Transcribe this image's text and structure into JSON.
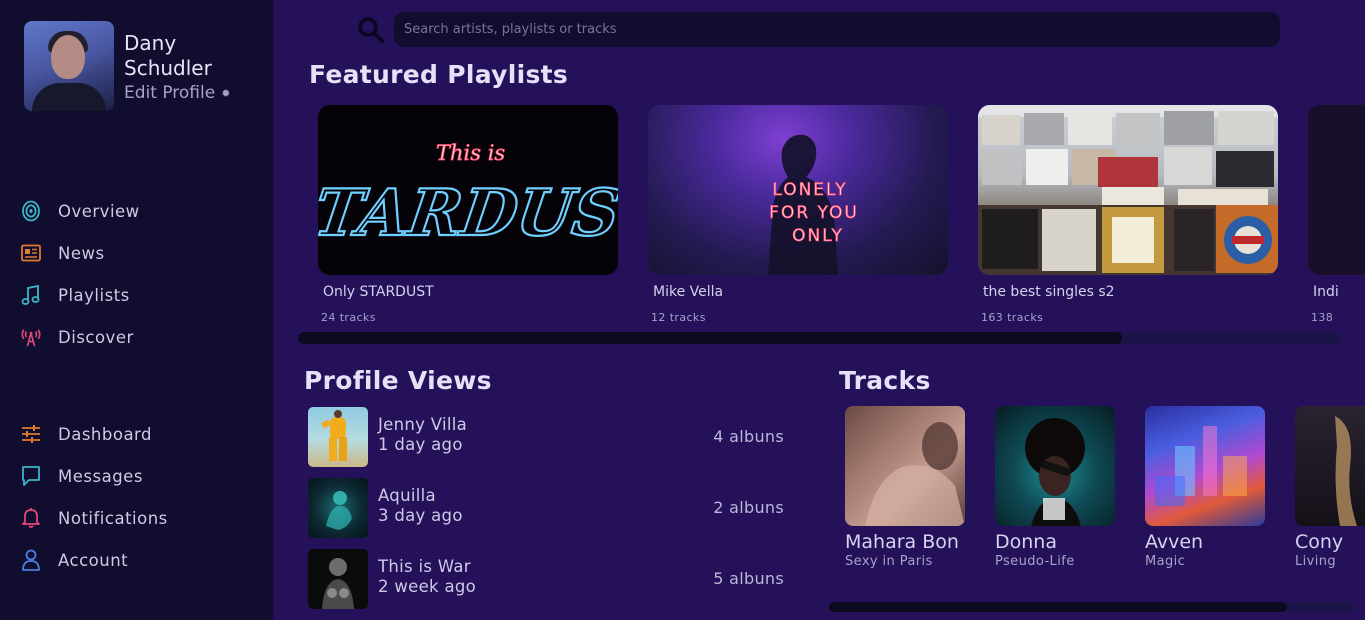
{
  "user": {
    "name": "Dany Schudler",
    "edit_label": "Edit Profile"
  },
  "nav": {
    "primary": [
      {
        "label": "Overview",
        "icon": "target-icon",
        "color": "#3bb5c7"
      },
      {
        "label": "News",
        "icon": "newspaper-icon",
        "color": "#e07a2f"
      },
      {
        "label": "Playlists",
        "icon": "music-note-icon",
        "color": "#3bb5c7"
      },
      {
        "label": "Discover",
        "icon": "broadcast-icon",
        "color": "#e0477a"
      }
    ],
    "secondary": [
      {
        "label": "Dashboard",
        "icon": "sliders-icon",
        "color": "#e07a2f"
      },
      {
        "label": "Messages",
        "icon": "chat-icon",
        "color": "#3bb5c7"
      },
      {
        "label": "Notifications",
        "icon": "bell-icon",
        "color": "#e0477a"
      },
      {
        "label": "Account",
        "icon": "user-icon",
        "color": "#4a7ee0"
      }
    ]
  },
  "search": {
    "placeholder": "Search artists, playlists or tracks"
  },
  "featured": {
    "title": "Featured Playlists",
    "playlists": [
      {
        "name": "Only STARDUST",
        "tracks": "24 tracks",
        "art_text_top": "This is",
        "art_text_main": "STARDUST"
      },
      {
        "name": "Mike Vella",
        "tracks": "12 tracks",
        "art_lines": [
          "LONELY",
          "FOR YOU",
          "ONLY"
        ]
      },
      {
        "name": "the best singles s2",
        "tracks": "163 tracks"
      },
      {
        "name": "Indi",
        "tracks": "138"
      }
    ],
    "scroll_fraction": 0.79
  },
  "profile_views": {
    "title": "Profile Views",
    "items": [
      {
        "name": "Jenny Villa",
        "time": "1 day ago",
        "albums": "4 albuns"
      },
      {
        "name": "Aquilla",
        "time": "3 day ago",
        "albums": "2 albuns"
      },
      {
        "name": "This is War",
        "time": "2 week ago",
        "albums": "5 albuns"
      }
    ]
  },
  "tracks": {
    "title": "Tracks",
    "items": [
      {
        "name": "Mahara Bon",
        "artist": "Sexy in Paris"
      },
      {
        "name": "Donna",
        "artist": "Pseudo-Life"
      },
      {
        "name": "Avven",
        "artist": "Magic"
      },
      {
        "name": "Cony",
        "artist": "Living"
      }
    ],
    "scroll_fraction": 0.87
  },
  "colors": {
    "background": "#24115a",
    "sidebar": "#110d2e",
    "neon_blue": "#5ab8ff",
    "neon_pink": "#ff5a7a"
  }
}
